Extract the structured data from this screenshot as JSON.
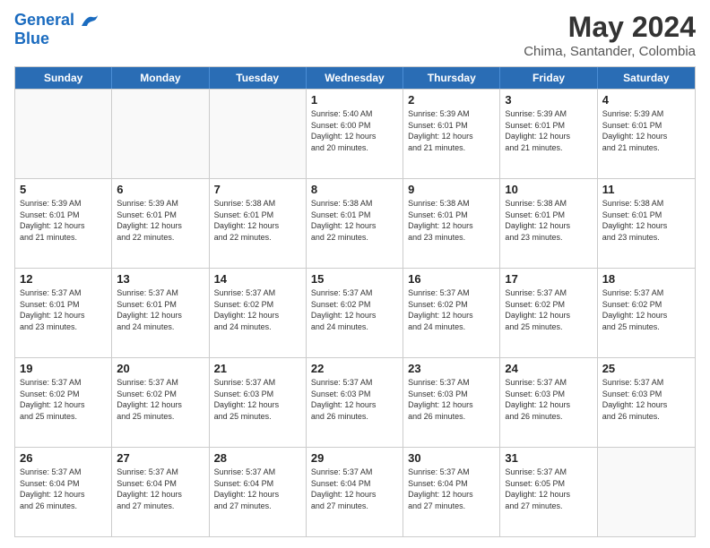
{
  "header": {
    "logo_line1": "General",
    "logo_line2": "Blue",
    "month_title": "May 2024",
    "location": "Chima, Santander, Colombia"
  },
  "days_of_week": [
    "Sunday",
    "Monday",
    "Tuesday",
    "Wednesday",
    "Thursday",
    "Friday",
    "Saturday"
  ],
  "weeks": [
    [
      {
        "day": "",
        "info": ""
      },
      {
        "day": "",
        "info": ""
      },
      {
        "day": "",
        "info": ""
      },
      {
        "day": "1",
        "info": "Sunrise: 5:40 AM\nSunset: 6:00 PM\nDaylight: 12 hours\nand 20 minutes."
      },
      {
        "day": "2",
        "info": "Sunrise: 5:39 AM\nSunset: 6:01 PM\nDaylight: 12 hours\nand 21 minutes."
      },
      {
        "day": "3",
        "info": "Sunrise: 5:39 AM\nSunset: 6:01 PM\nDaylight: 12 hours\nand 21 minutes."
      },
      {
        "day": "4",
        "info": "Sunrise: 5:39 AM\nSunset: 6:01 PM\nDaylight: 12 hours\nand 21 minutes."
      }
    ],
    [
      {
        "day": "5",
        "info": "Sunrise: 5:39 AM\nSunset: 6:01 PM\nDaylight: 12 hours\nand 21 minutes."
      },
      {
        "day": "6",
        "info": "Sunrise: 5:39 AM\nSunset: 6:01 PM\nDaylight: 12 hours\nand 22 minutes."
      },
      {
        "day": "7",
        "info": "Sunrise: 5:38 AM\nSunset: 6:01 PM\nDaylight: 12 hours\nand 22 minutes."
      },
      {
        "day": "8",
        "info": "Sunrise: 5:38 AM\nSunset: 6:01 PM\nDaylight: 12 hours\nand 22 minutes."
      },
      {
        "day": "9",
        "info": "Sunrise: 5:38 AM\nSunset: 6:01 PM\nDaylight: 12 hours\nand 23 minutes."
      },
      {
        "day": "10",
        "info": "Sunrise: 5:38 AM\nSunset: 6:01 PM\nDaylight: 12 hours\nand 23 minutes."
      },
      {
        "day": "11",
        "info": "Sunrise: 5:38 AM\nSunset: 6:01 PM\nDaylight: 12 hours\nand 23 minutes."
      }
    ],
    [
      {
        "day": "12",
        "info": "Sunrise: 5:37 AM\nSunset: 6:01 PM\nDaylight: 12 hours\nand 23 minutes."
      },
      {
        "day": "13",
        "info": "Sunrise: 5:37 AM\nSunset: 6:01 PM\nDaylight: 12 hours\nand 24 minutes."
      },
      {
        "day": "14",
        "info": "Sunrise: 5:37 AM\nSunset: 6:02 PM\nDaylight: 12 hours\nand 24 minutes."
      },
      {
        "day": "15",
        "info": "Sunrise: 5:37 AM\nSunset: 6:02 PM\nDaylight: 12 hours\nand 24 minutes."
      },
      {
        "day": "16",
        "info": "Sunrise: 5:37 AM\nSunset: 6:02 PM\nDaylight: 12 hours\nand 24 minutes."
      },
      {
        "day": "17",
        "info": "Sunrise: 5:37 AM\nSunset: 6:02 PM\nDaylight: 12 hours\nand 25 minutes."
      },
      {
        "day": "18",
        "info": "Sunrise: 5:37 AM\nSunset: 6:02 PM\nDaylight: 12 hours\nand 25 minutes."
      }
    ],
    [
      {
        "day": "19",
        "info": "Sunrise: 5:37 AM\nSunset: 6:02 PM\nDaylight: 12 hours\nand 25 minutes."
      },
      {
        "day": "20",
        "info": "Sunrise: 5:37 AM\nSunset: 6:02 PM\nDaylight: 12 hours\nand 25 minutes."
      },
      {
        "day": "21",
        "info": "Sunrise: 5:37 AM\nSunset: 6:03 PM\nDaylight: 12 hours\nand 25 minutes."
      },
      {
        "day": "22",
        "info": "Sunrise: 5:37 AM\nSunset: 6:03 PM\nDaylight: 12 hours\nand 26 minutes."
      },
      {
        "day": "23",
        "info": "Sunrise: 5:37 AM\nSunset: 6:03 PM\nDaylight: 12 hours\nand 26 minutes."
      },
      {
        "day": "24",
        "info": "Sunrise: 5:37 AM\nSunset: 6:03 PM\nDaylight: 12 hours\nand 26 minutes."
      },
      {
        "day": "25",
        "info": "Sunrise: 5:37 AM\nSunset: 6:03 PM\nDaylight: 12 hours\nand 26 minutes."
      }
    ],
    [
      {
        "day": "26",
        "info": "Sunrise: 5:37 AM\nSunset: 6:04 PM\nDaylight: 12 hours\nand 26 minutes."
      },
      {
        "day": "27",
        "info": "Sunrise: 5:37 AM\nSunset: 6:04 PM\nDaylight: 12 hours\nand 27 minutes."
      },
      {
        "day": "28",
        "info": "Sunrise: 5:37 AM\nSunset: 6:04 PM\nDaylight: 12 hours\nand 27 minutes."
      },
      {
        "day": "29",
        "info": "Sunrise: 5:37 AM\nSunset: 6:04 PM\nDaylight: 12 hours\nand 27 minutes."
      },
      {
        "day": "30",
        "info": "Sunrise: 5:37 AM\nSunset: 6:04 PM\nDaylight: 12 hours\nand 27 minutes."
      },
      {
        "day": "31",
        "info": "Sunrise: 5:37 AM\nSunset: 6:05 PM\nDaylight: 12 hours\nand 27 minutes."
      },
      {
        "day": "",
        "info": ""
      }
    ]
  ]
}
